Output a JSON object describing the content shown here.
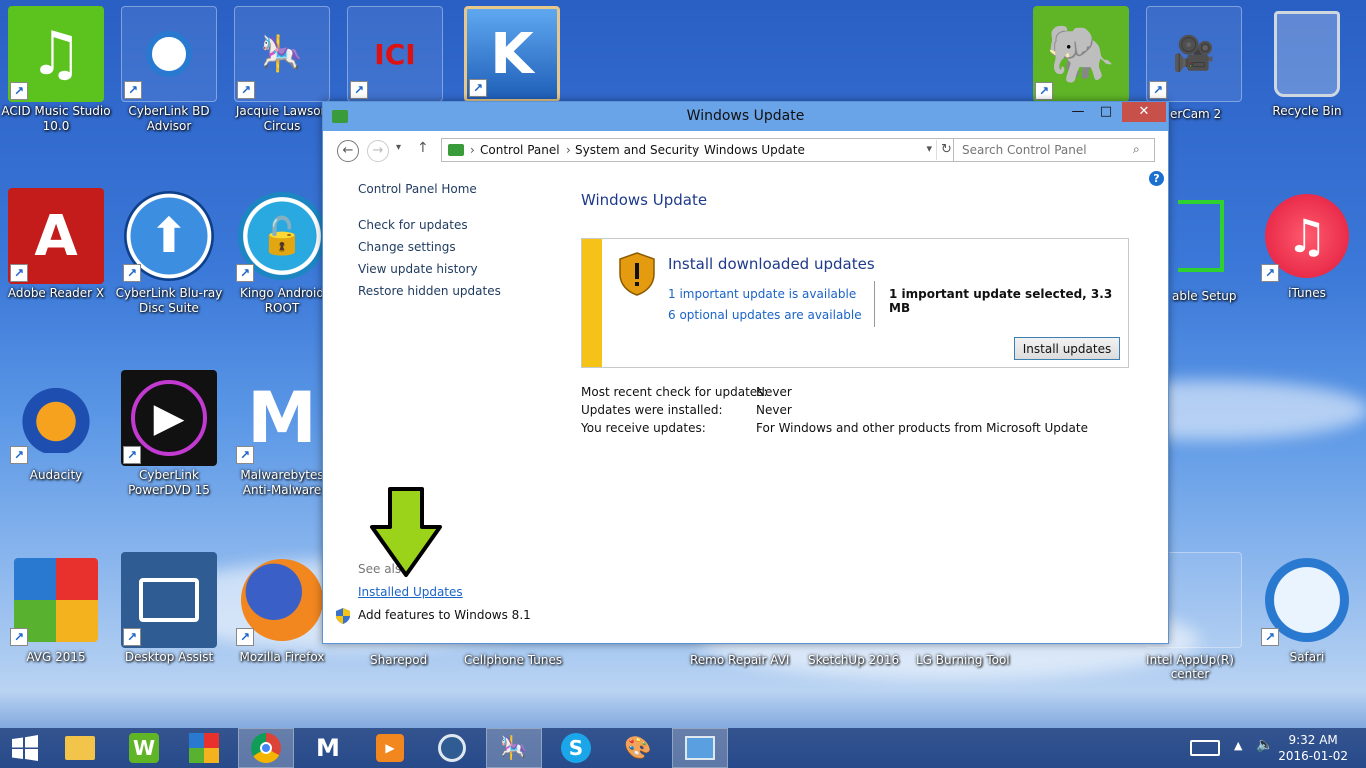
{
  "desktop": {
    "icons": [
      {
        "label1": "ACID Music Studio",
        "label2": "10.0"
      },
      {
        "label1": "CyberLink BD",
        "label2": "Advisor"
      },
      {
        "label1": "Jacquie Lawson",
        "label2": "Circus"
      },
      {
        "label1": "Recycle Bin"
      },
      {
        "label1": "Adobe Reader X"
      },
      {
        "label1": "CyberLink Blu-ray",
        "label2": "Disc Suite"
      },
      {
        "label1": "Kingo Android",
        "label2": "ROOT"
      },
      {
        "label1": "iTunes"
      },
      {
        "label1": "Audacity"
      },
      {
        "label1": "CyberLink",
        "label2": "PowerDVD 15"
      },
      {
        "label1": "Malwarebytes",
        "label2": "Anti-Malware"
      },
      {
        "label1": "AVG 2015"
      },
      {
        "label1": "Desktop Assist"
      },
      {
        "label1": "Mozilla Firefox"
      },
      {
        "label1": "Safari"
      }
    ],
    "partial_labels": {
      "hypercam": "erCam 2",
      "portable_setup": "able Setup",
      "sharepod": "Sharepod",
      "cellphone": "Cellphone Tunes",
      "remo": "Remo Repair AVI",
      "sketchup": "SketchUp 2016",
      "lg": "LG Burning Tool",
      "intel1": "Intel AppUp(R)",
      "intel2": "center"
    },
    "tile_text": {
      "k5": "K"
    }
  },
  "window": {
    "title": "Windows Update",
    "minimize": "—",
    "maximize": "□",
    "close": "✕",
    "address": {
      "crumbs": [
        "Control Panel",
        "System and Security",
        "Windows Update"
      ],
      "separator": "›"
    },
    "search_placeholder": "Search Control Panel",
    "help": "?",
    "left_nav": {
      "home": "Control Panel Home",
      "items": [
        "Check for updates",
        "Change settings",
        "View update history",
        "Restore hidden updates"
      ]
    },
    "main_title": "Windows Update",
    "panel": {
      "heading": "Install downloaded updates",
      "important_link": "1 important update is available",
      "optional_link": "6 optional updates are available",
      "selected": "1 important update selected, 3.3 MB",
      "button": "Install updates",
      "accent": "#f5c318"
    },
    "info": [
      {
        "k": "Most recent check for updates:",
        "v": "Never"
      },
      {
        "k": "Updates were installed:",
        "v": "Never"
      },
      {
        "k": "You receive updates:",
        "v": "For Windows and other products from Microsoft Update"
      }
    ],
    "see_also": "See also",
    "installed_updates": "Installed Updates",
    "add_features": "Add features to Windows 8.1"
  },
  "taskbar": {
    "time": "9:32 AM",
    "date": "2016-01-02"
  },
  "colors": {
    "link": "#1a63c7",
    "title_blue": "#1e3a8a",
    "arrow": "#9bd31b"
  }
}
